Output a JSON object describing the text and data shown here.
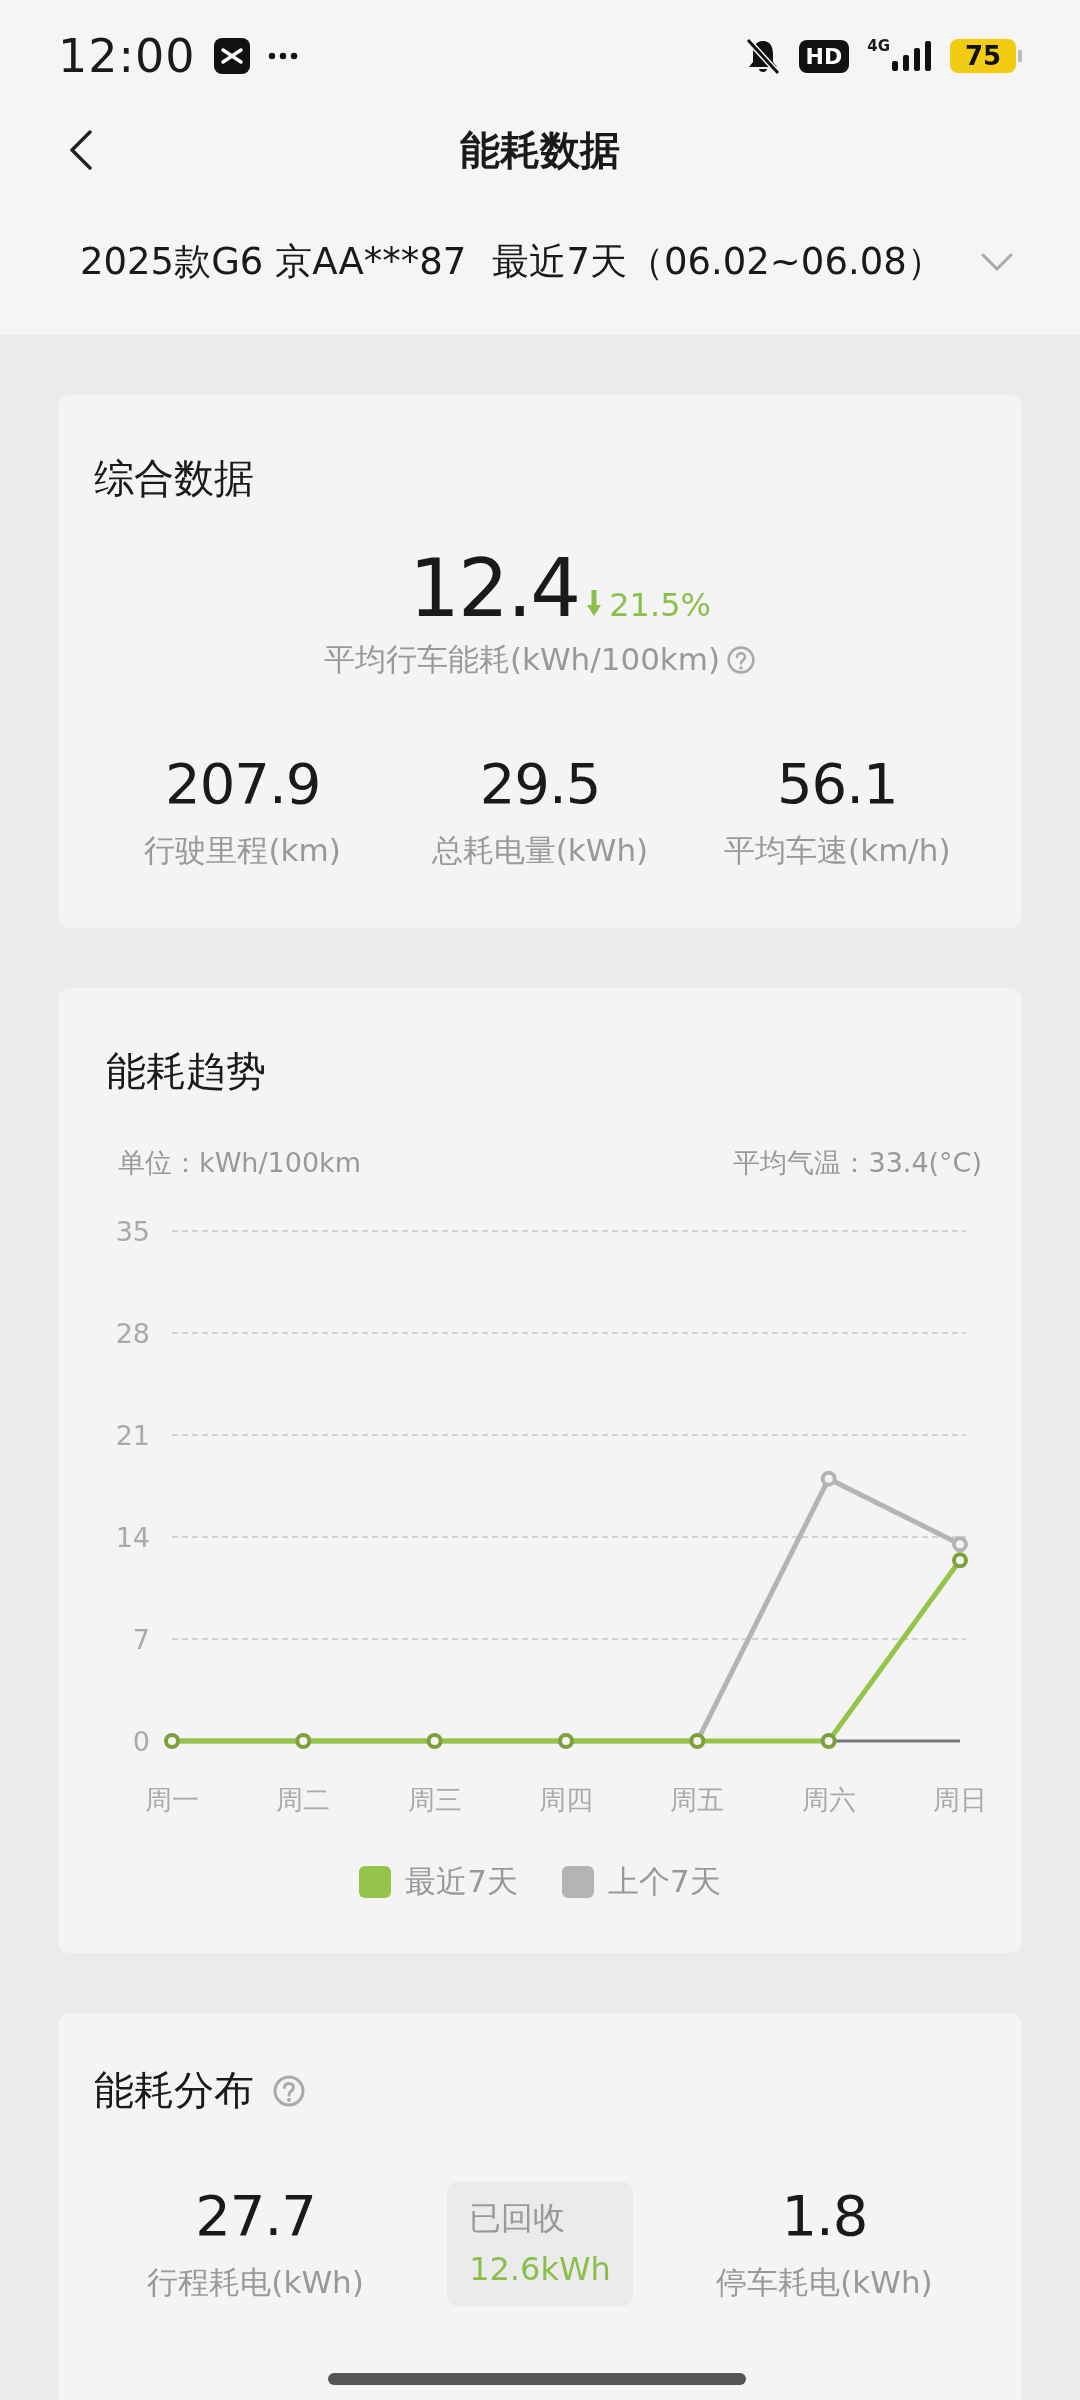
{
  "status_bar": {
    "time": "12:00",
    "hd": "HD",
    "network": "4G",
    "battery": "75"
  },
  "header": {
    "title": "能耗数据"
  },
  "selector": {
    "vehicle": "2025款G6 京AA***87",
    "period": "最近7天（06.02~06.08）"
  },
  "summary": {
    "title": "综合数据",
    "main": {
      "value": "12.4",
      "change": "21.5%",
      "label": "平均行车能耗(kWh/100km)"
    },
    "stats": [
      {
        "value": "207.9",
        "label": "行驶里程(km)"
      },
      {
        "value": "29.5",
        "label": "总耗电量(kWh)"
      },
      {
        "value": "56.1",
        "label": "平均车速(km/h)"
      }
    ]
  },
  "trend": {
    "title": "能耗趋势",
    "unit": "单位：kWh/100km",
    "temperature": "平均气温：33.4(°C)",
    "chart_data": {
      "type": "line",
      "categories": [
        "周一",
        "周二",
        "周三",
        "周四",
        "周五",
        "周六",
        "周日"
      ],
      "ylim": [
        0,
        35
      ],
      "yticks": [
        0,
        7,
        14,
        21,
        28,
        35
      ],
      "grid": true,
      "series": [
        {
          "name": "最近7天",
          "color": "#94c54a",
          "marker": true,
          "values": [
            0,
            0,
            0,
            0,
            0,
            0,
            12.4
          ]
        },
        {
          "name": "上个7天",
          "color": "#b4b4b4",
          "marker": true,
          "values": [
            0,
            0,
            0,
            0,
            0,
            18,
            13.5
          ]
        }
      ]
    }
  },
  "distribution": {
    "title": "能耗分布",
    "items": [
      {
        "kind": "stat",
        "value": "27.7",
        "label": "行程耗电(kWh)"
      },
      {
        "kind": "recovered",
        "label": "已回收",
        "value": "12.6kWh"
      },
      {
        "kind": "stat",
        "value": "1.8",
        "label": "停车耗电(kWh)"
      }
    ]
  }
}
